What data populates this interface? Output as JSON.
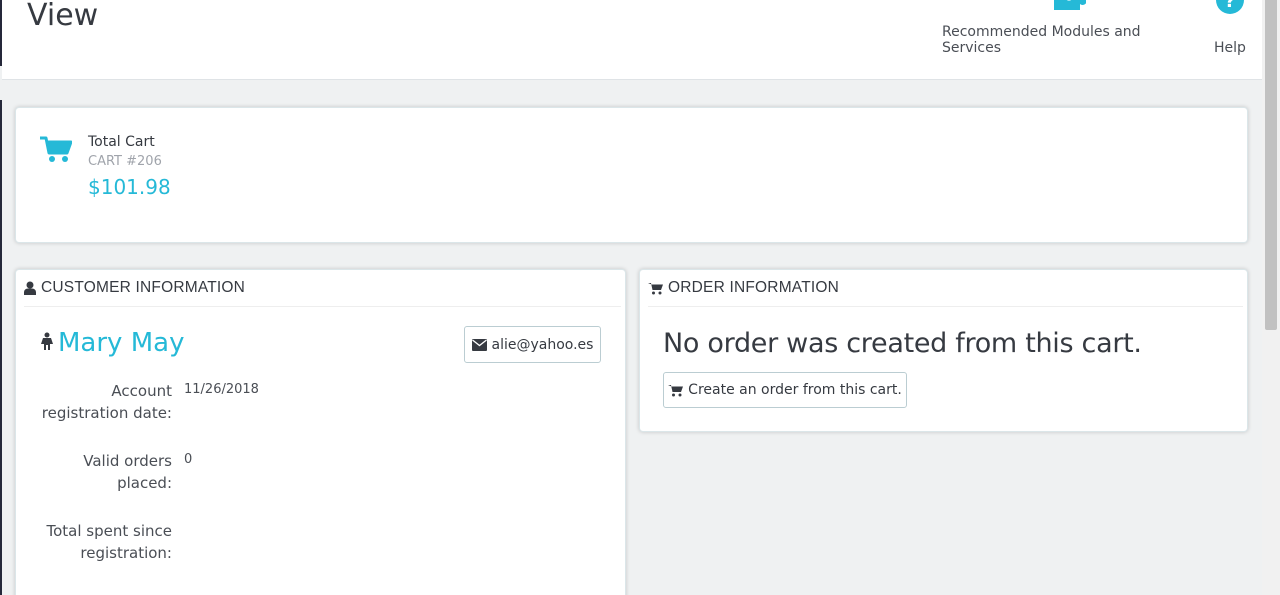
{
  "header": {
    "title": "View",
    "toolbar": {
      "modules_label": "Recommended Modules and Services",
      "help_label": "Help"
    }
  },
  "kpi": {
    "label": "Total Cart",
    "cart_ref": "CART #206",
    "value": "$101.98",
    "icon": "shopping-cart-icon"
  },
  "customer_panel": {
    "heading": "CUSTOMER INFORMATION",
    "name": "Mary May",
    "email": "alie@yahoo.es",
    "rows": [
      {
        "label": "Account registration date:",
        "value": "11/26/2018"
      },
      {
        "label": "Valid orders placed:",
        "value": "0"
      },
      {
        "label": "Total spent since registration:",
        "value": ""
      }
    ]
  },
  "order_panel": {
    "heading": "ORDER INFORMATION",
    "message": "No order was created from this cart.",
    "create_button": "Create an order from this cart."
  },
  "colors": {
    "accent": "#25b9d7",
    "text": "#363a41",
    "background": "#eff1f2"
  }
}
